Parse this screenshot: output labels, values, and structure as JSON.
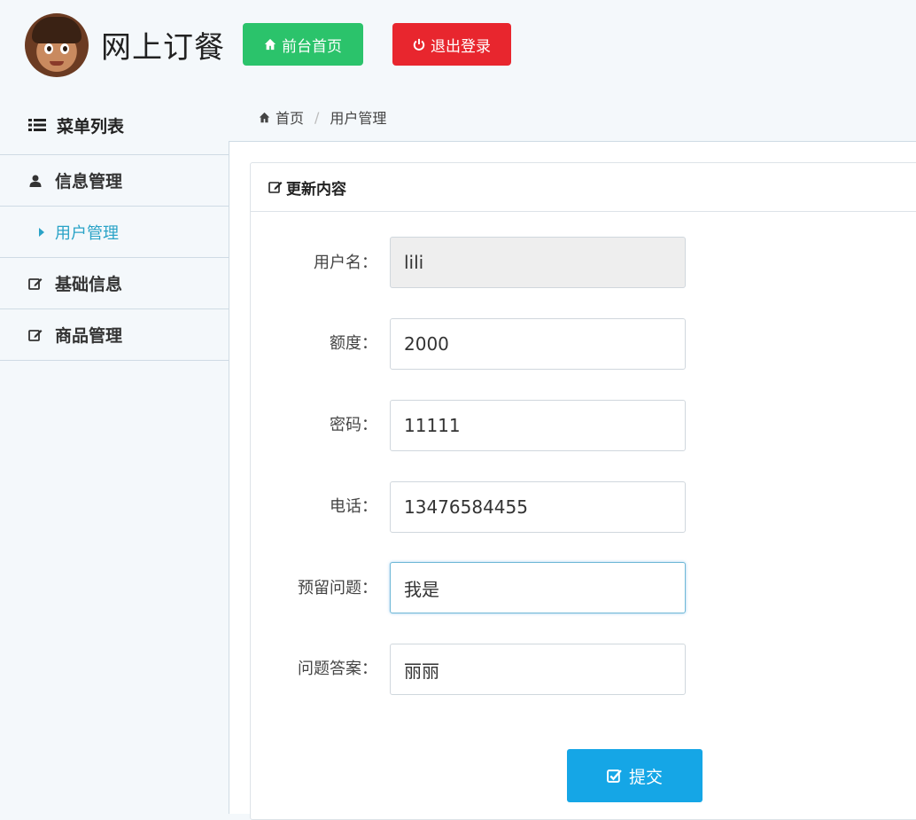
{
  "header": {
    "app_title": "网上订餐",
    "home_button": "前台首页",
    "logout_button": "退出登录"
  },
  "sidebar": {
    "menu_title": "菜单列表",
    "items": [
      {
        "label": "信息管理",
        "icon": "user-icon"
      },
      {
        "label": "用户管理",
        "icon": "caret-right-icon",
        "active": true
      },
      {
        "label": "基础信息",
        "icon": "edit-icon"
      },
      {
        "label": "商品管理",
        "icon": "edit-icon"
      }
    ]
  },
  "breadcrumb": {
    "home": "首页",
    "current": "用户管理"
  },
  "panel": {
    "title": "更新内容"
  },
  "form": {
    "username": {
      "label": "用户名：",
      "value": "lili"
    },
    "quota": {
      "label": "额度：",
      "value": "2000"
    },
    "password": {
      "label": "密码：",
      "value": "11111"
    },
    "phone": {
      "label": "电话：",
      "value": "13476584455"
    },
    "question": {
      "label": "预留问题：",
      "value": "我是"
    },
    "answer": {
      "label": "问题答案：",
      "value": "丽丽"
    },
    "submit": "提交"
  },
  "colors": {
    "home_button": "#2bc36b",
    "logout_button": "#e8262e",
    "submit_button": "#15a6e6",
    "active_link": "#2aa3c7"
  }
}
